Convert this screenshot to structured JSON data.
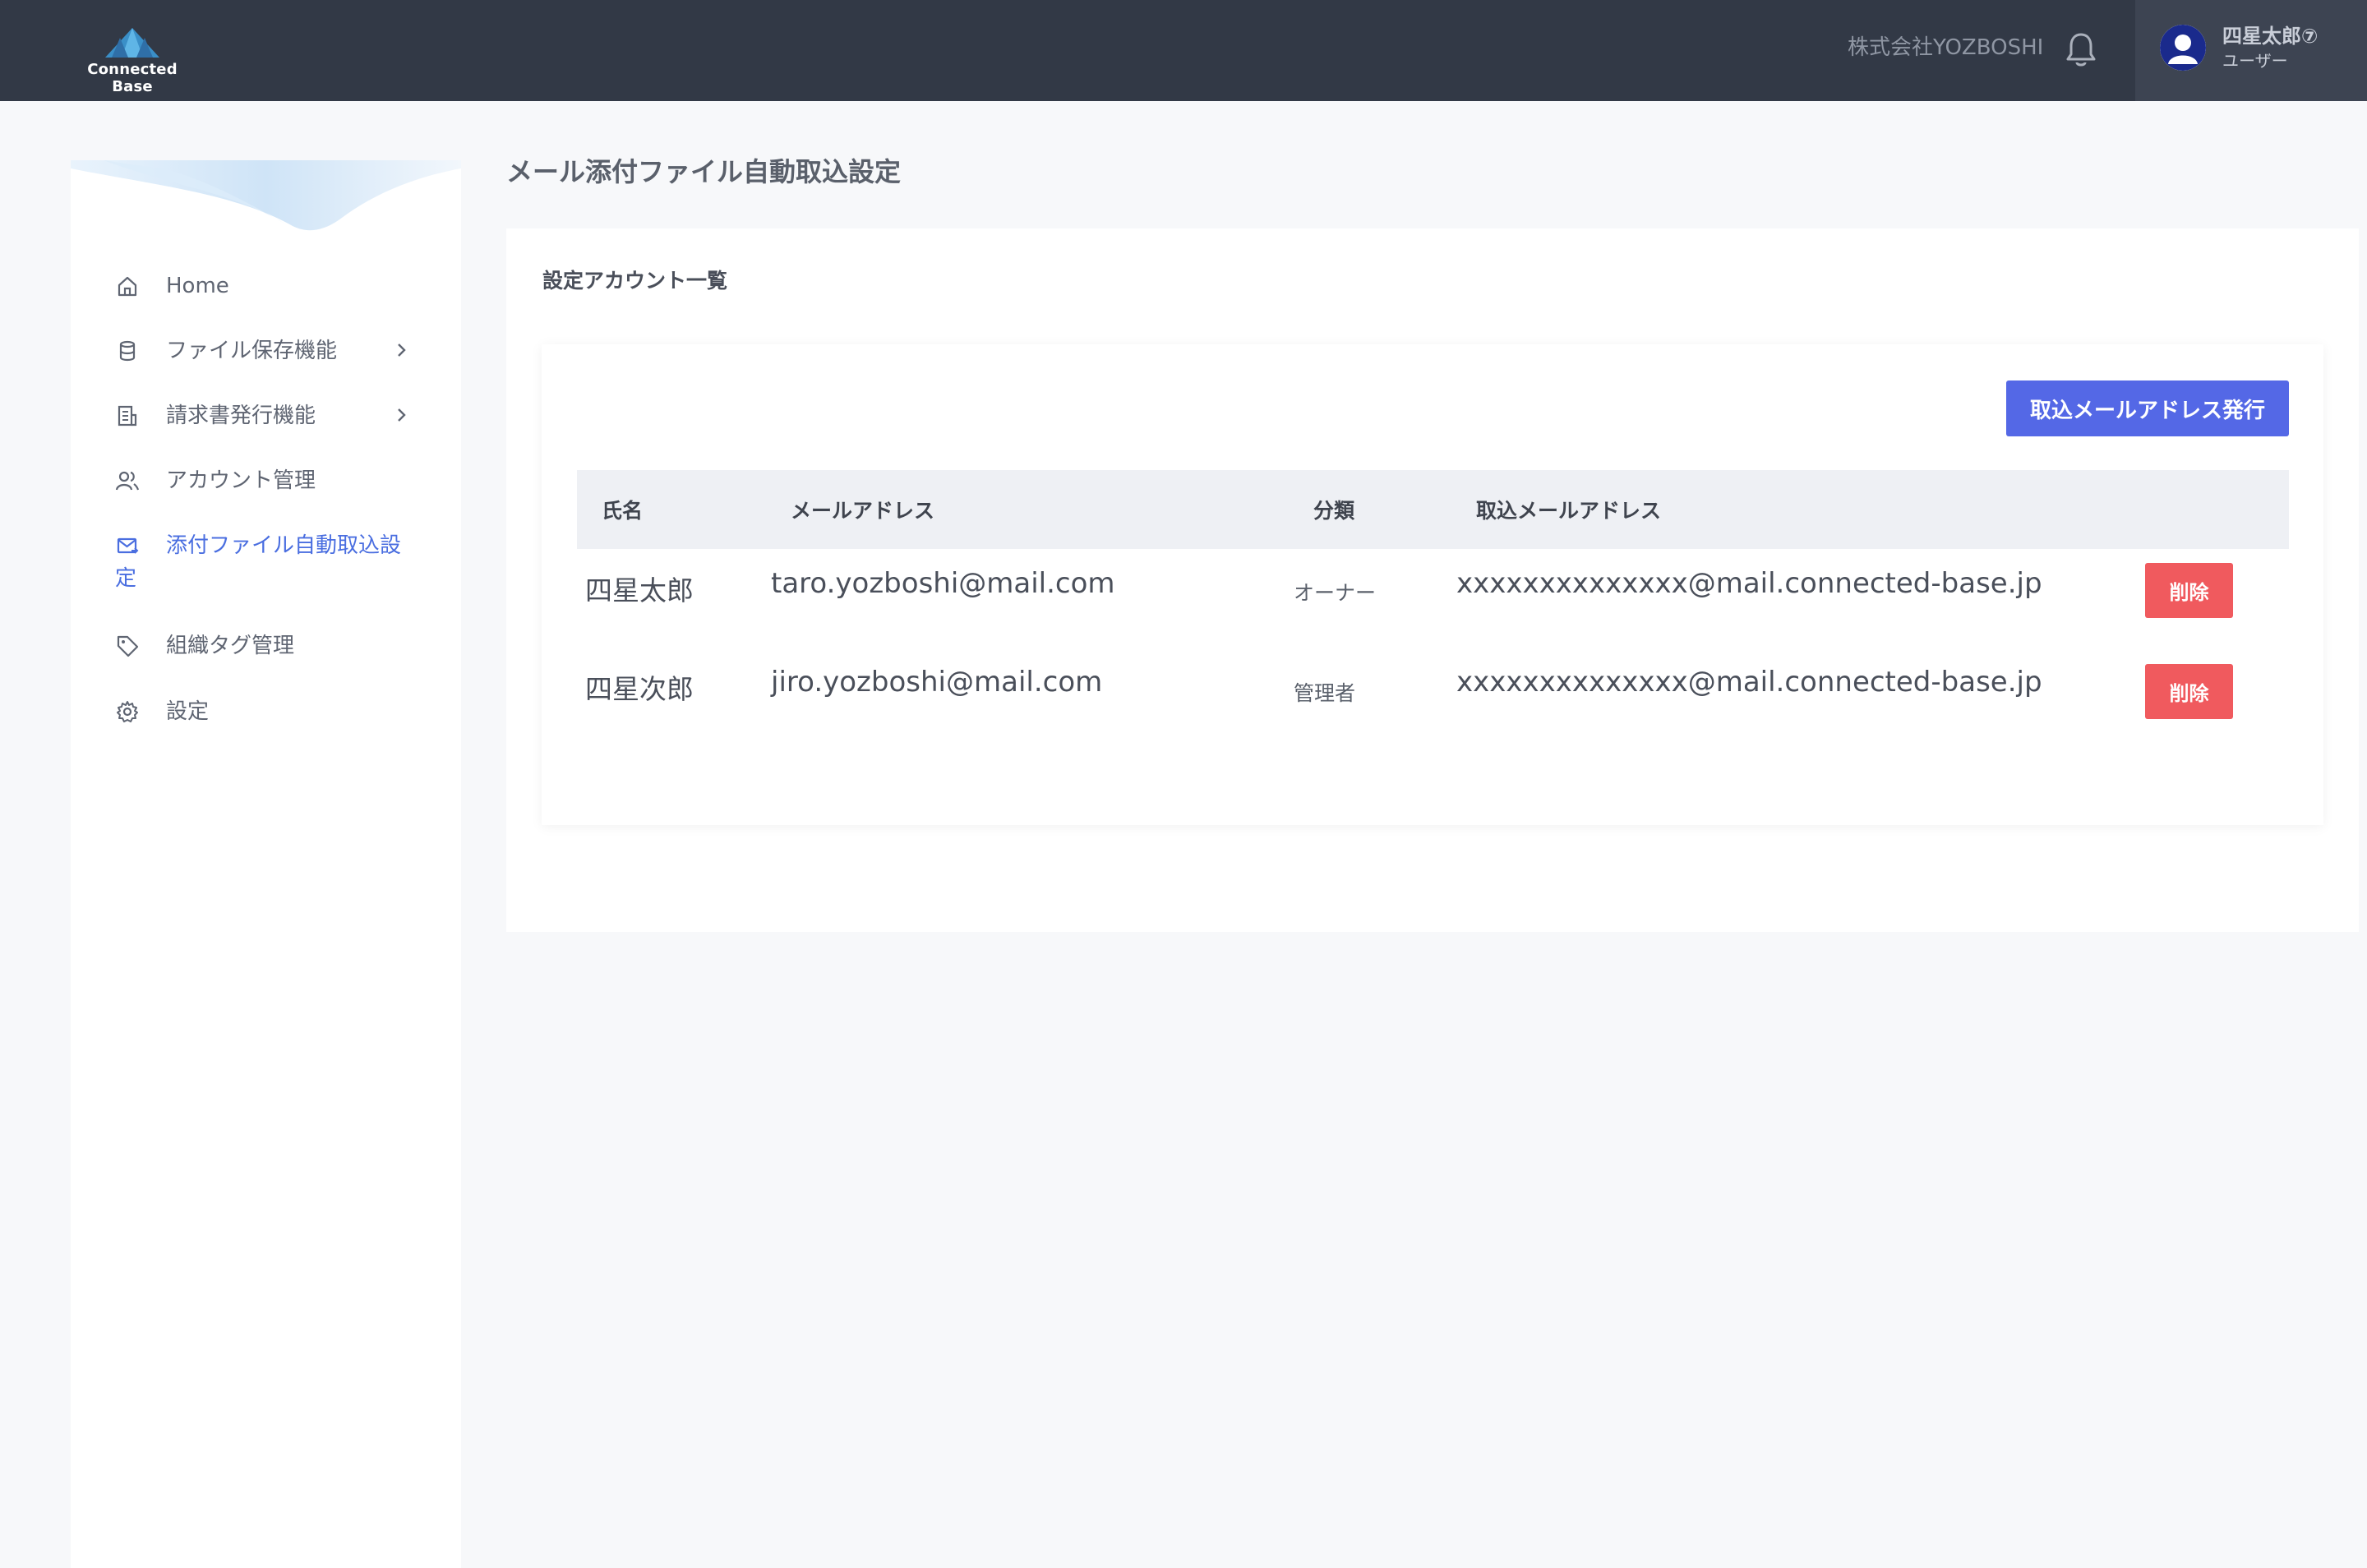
{
  "header": {
    "logo_text": "Connected Base",
    "company": "株式会社YOZBOSHI",
    "user_name": "四星太郎⑦",
    "user_role": "ユーザー"
  },
  "sidebar": {
    "items": [
      {
        "label": "Home",
        "icon": "home-icon"
      },
      {
        "label": "ファイル保存機能",
        "icon": "database-icon",
        "has_submenu": true
      },
      {
        "label": "請求書発行機能",
        "icon": "invoice-icon",
        "has_submenu": true
      },
      {
        "label": "アカウント管理",
        "icon": "users-icon"
      },
      {
        "label_line1": "添付ファイル自動取込設",
        "label_line2": "定",
        "icon": "mail-sync-icon",
        "active": true
      },
      {
        "label": "組織タグ管理",
        "icon": "tag-icon"
      },
      {
        "label": "設定",
        "icon": "gear-icon"
      }
    ]
  },
  "main": {
    "title": "メール添付ファイル自動取込設定",
    "card_title": "設定アカウント一覧",
    "issue_button": "取込メールアドレス発行",
    "table": {
      "headers": [
        "氏名",
        "メールアドレス",
        "分類",
        "取込メールアドレス"
      ],
      "rows": [
        {
          "name": "四星太郎",
          "email": "taro.yozboshi@mail.com",
          "type": "オーナー",
          "import_email": "xxxxxxxxxxxxxx@mail.connected-base.jp",
          "action": "削除"
        },
        {
          "name": "四星次郎",
          "email": "jiro.yozboshi@mail.com",
          "type": "管理者",
          "import_email": "xxxxxxxxxxxxxx@mail.connected-base.jp",
          "action": "削除"
        }
      ]
    }
  },
  "colors": {
    "header_bg": "#323946",
    "accent": "#5468e6",
    "danger": "#f05a5e",
    "active_nav": "#4a6ee0"
  }
}
